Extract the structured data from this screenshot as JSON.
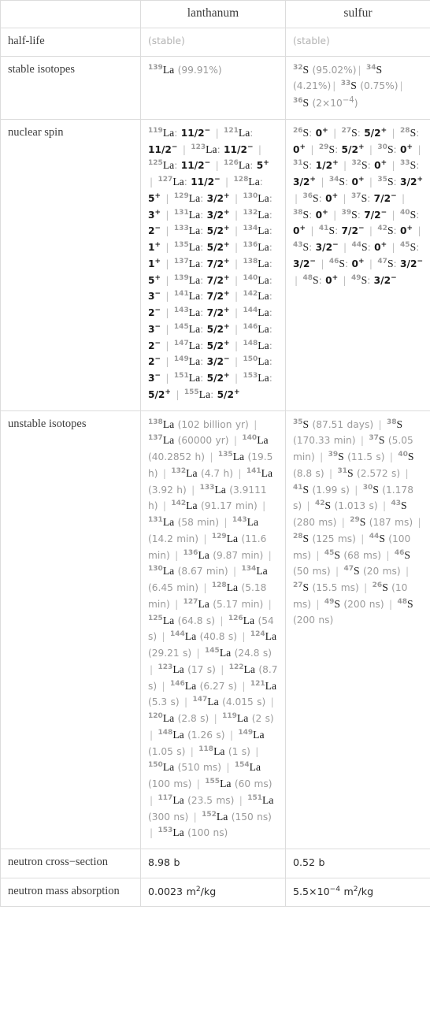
{
  "table": {
    "columns": [
      "",
      "lanthanum",
      "sulfur"
    ],
    "rows": [
      {
        "label": "half-life",
        "lanthanum": "(stable)",
        "sulfur": "(stable)"
      },
      {
        "label": "stable isotopes",
        "lanthanum": "139La (99.91%)",
        "sulfur": "32S (95.02%) | 34S (4.21%) | 33S (0.75%) | 36S (2×10^-4)"
      },
      {
        "label": "nuclear spin",
        "lanthanum": "119La: 11/2- | 121La: 11/2- | 123La: 11/2- | 125La: 11/2- | 126La: 5+ | 127La: 11/2- | 128La: 5+ | 129La: 3/2+ | 130La: 3+ | 131La: 3/2+ | 132La: 2- | 133La: 5/2+ | 134La: 1+ | 135La: 5/2+ | 136La: 1+ | 137La: 7/2+ | 138La: 5+ | 139La: 7/2+ | 140La: 3- | 141La: 7/2+ | 142La: 2- | 143La: 7/2+ | 144La: 3- | 145La: 5/2+ | 146La: 2- | 147La: 5/2+ | 148La: 2- | 149La: 3/2- | 150La: 3- | 151La: 5/2+ | 153La: 5/2+ | 155La: 5/2+",
        "sulfur": "26S: 0+ | 27S: 5/2+ | 28S: 0+ | 29S: 5/2+ | 30S: 0+ | 31S: 1/2+ | 32S: 0+ | 33S: 3/2+ | 34S: 0+ | 35S: 3/2+ | 36S: 0+ | 37S: 7/2- | 38S: 0+ | 39S: 7/2- | 40S: 0+ | 41S: 7/2- | 42S: 0+ | 43S: 3/2- | 44S: 0+ | 45S: 3/2- | 46S: 0+ | 47S: 3/2- | 48S: 0+ | 49S: 3/2-"
      },
      {
        "label": "unstable isotopes",
        "lanthanum": "138La (102 billion yr) | 137La (60000 yr) | 140La (40.2852 h) | 135La (19.5 h) | 132La (4.7 h) | 141La (3.92 h) | 133La (3.9111 h) | 142La (91.17 min) | 131La (58 min) | 143La (14.2 min) | 129La (11.6 min) | 136La (9.87 min) | 130La (8.67 min) | 134La (6.45 min) | 128La (5.18 min) | 127La (5.17 min) | 125La (64.8 s) | 126La (54 s) | 144La (40.8 s) | 124La (29.21 s) | 145La (24.8 s) | 123La (17 s) | 122La (8.7 s) | 146La (6.27 s) | 121La (5.3 s) | 147La (4.015 s) | 120La (2.8 s) | 119La (2 s) | 148La (1.26 s) | 149La (1.05 s) | 118La (1 s) | 150La (510 ms) | 154La (100 ms) | 155La (60 ms) | 117La (23.5 ms) | 151La (300 ns) | 152La (150 ns) | 153La (100 ns)",
        "sulfur": "35S (87.51 days) | 38S (170.33 min) | 37S (5.05 min) | 39S (11.5 s) | 40S (8.8 s) | 31S (2.572 s) | 41S (1.99 s) | 30S (1.178 s) | 42S (1.013 s) | 43S (280 ms) | 29S (187 ms) | 28S (125 ms) | 44S (100 ms) | 45S (68 ms) | 46S (50 ms) | 47S (20 ms) | 27S (15.5 ms) | 26S (10 ms) | 49S (200 ns) | 48S (200 ns)"
      },
      {
        "label": "neutron cross-section",
        "lanthanum": "8.98 b",
        "sulfur": "0.52 b"
      },
      {
        "label": "neutron mass absorption",
        "lanthanum": "0.0023 m^2/kg",
        "sulfur": "5.5×10^-4 m^2/kg"
      }
    ]
  },
  "labels": {
    "col_lanthanum": "lanthanum",
    "col_sulfur": "sulfur",
    "half_life": "half-life",
    "stable_isotopes": "stable isotopes",
    "nuclear_spin": "nuclear spin",
    "unstable_isotopes": "unstable isotopes",
    "neutron_cross_section": "neutron cross−section",
    "neutron_mass_absorption": "neutron mass absorption"
  },
  "values": {
    "half_life_la": "(stable)",
    "half_life_s": "(stable)",
    "ncs_la": "8.98 b",
    "ncs_s": "0.52 b",
    "nma_la_num": "0.0023",
    "nma_la_unit": "m",
    "nma_la_exp": "2",
    "nma_la_tail": "/kg",
    "nma_s_num": "5.5×10",
    "nma_s_numexp": "−4",
    "nma_s_unit": "m",
    "nma_s_exp": "2",
    "nma_s_tail": "/kg"
  },
  "colors": {
    "border": "#dcdcdc",
    "label_text": "#3d3d3d",
    "dim_text": "#9a9a9a",
    "strong_text": "#1a1a1a",
    "separator": "#bdbdbd"
  }
}
